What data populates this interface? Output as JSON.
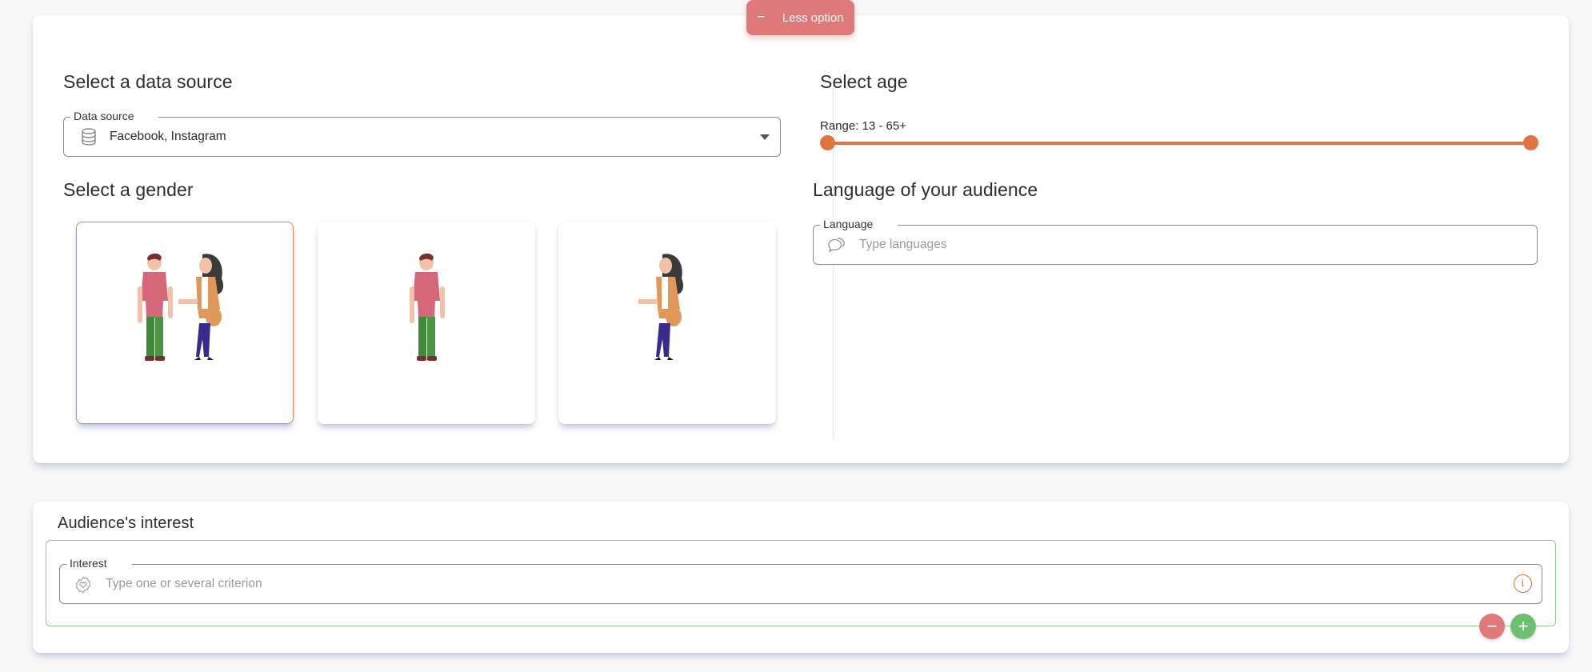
{
  "toggle": {
    "less_option_label": "Less option",
    "icon": "minus-icon"
  },
  "colors": {
    "accent": "#e07440",
    "danger": "#e07a7a",
    "success": "#6fbf73"
  },
  "data_source": {
    "title": "Select a data source",
    "field_label": "Data source",
    "value": "Facebook, Instagram",
    "icon": "database-icon"
  },
  "gender": {
    "title": "Select a gender",
    "options": [
      {
        "name": "all",
        "selected": true
      },
      {
        "name": "male",
        "selected": false
      },
      {
        "name": "female",
        "selected": false
      }
    ]
  },
  "age": {
    "title": "Select age",
    "range_label": "Range: 13 - 65+",
    "min": 13,
    "max": "65+",
    "lower_fraction": 0,
    "upper_fraction": 1
  },
  "language": {
    "title": "Language of your audience",
    "field_label": "Language",
    "placeholder": "Type languages",
    "icon": "chat-bubbles-icon"
  },
  "interest": {
    "title": "Audience's interest",
    "field_label": "Interest",
    "placeholder": "Type one or several criterion",
    "icon": "heart-badge-icon",
    "info_glyph": "i",
    "remove_glyph": "−",
    "add_glyph": "+"
  }
}
